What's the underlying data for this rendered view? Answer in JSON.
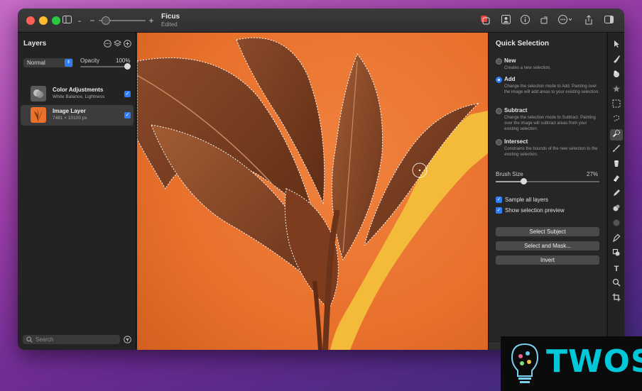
{
  "window": {
    "doc_title": "Ficus",
    "doc_subtitle": "Edited",
    "zoom_minus": "−",
    "zoom_plus": "+"
  },
  "layers_panel": {
    "title": "Layers",
    "blend_mode": "Normal",
    "opacity_label": "Opacity",
    "opacity_value": "100%",
    "layers": [
      {
        "name": "Color Adjustments",
        "subtitle": "White Balance, Lightness",
        "visible": true,
        "selected": false
      },
      {
        "name": "Image Layer",
        "subtitle": "7481 × 10100 px",
        "visible": true,
        "selected": true
      }
    ],
    "search_placeholder": "Search"
  },
  "quick_selection": {
    "title": "Quick Selection",
    "modes": [
      {
        "label": "New",
        "description": "Creates a new selection.",
        "selected": false
      },
      {
        "label": "Add",
        "description": "Change the selection mode to Add. Painting over the image will add areas to your existing selection.",
        "selected": true
      },
      {
        "label": "Subtract",
        "description": "Change the selection mode to Subtract. Painting over the image will subtract areas from your existing selection.",
        "selected": false
      },
      {
        "label": "Intersect",
        "description": "Constrains the bounds of the new selection to the existing selection.",
        "selected": false
      }
    ],
    "brush_size_label": "Brush Size",
    "brush_size_value": "27%",
    "brush_size_fraction": 0.27,
    "sample_all_layers": "Sample all layers",
    "show_selection_preview": "Show selection preview",
    "buttons": {
      "select_subject": "Select Subject",
      "select_and_mask": "Select and Mask...",
      "invert": "Invert"
    }
  },
  "tools": [
    "arrow-tool-icon",
    "brush-select-icon",
    "fill-icon",
    "star-icon",
    "rect-select-icon",
    "lasso-icon",
    "quick-select-icon",
    "paint-brush-icon",
    "bucket-icon",
    "eraser-icon",
    "pencil-icon",
    "smudge-icon",
    "blur-icon",
    "pen-icon",
    "shape-icon",
    "text-icon",
    "zoom-icon",
    "crop-icon"
  ],
  "watermark": {
    "text": "TWOS"
  },
  "colors": {
    "accent": "#2f7ef6",
    "canvas_orange": "#e8712c",
    "selection_yellow": "#f5c23c"
  }
}
